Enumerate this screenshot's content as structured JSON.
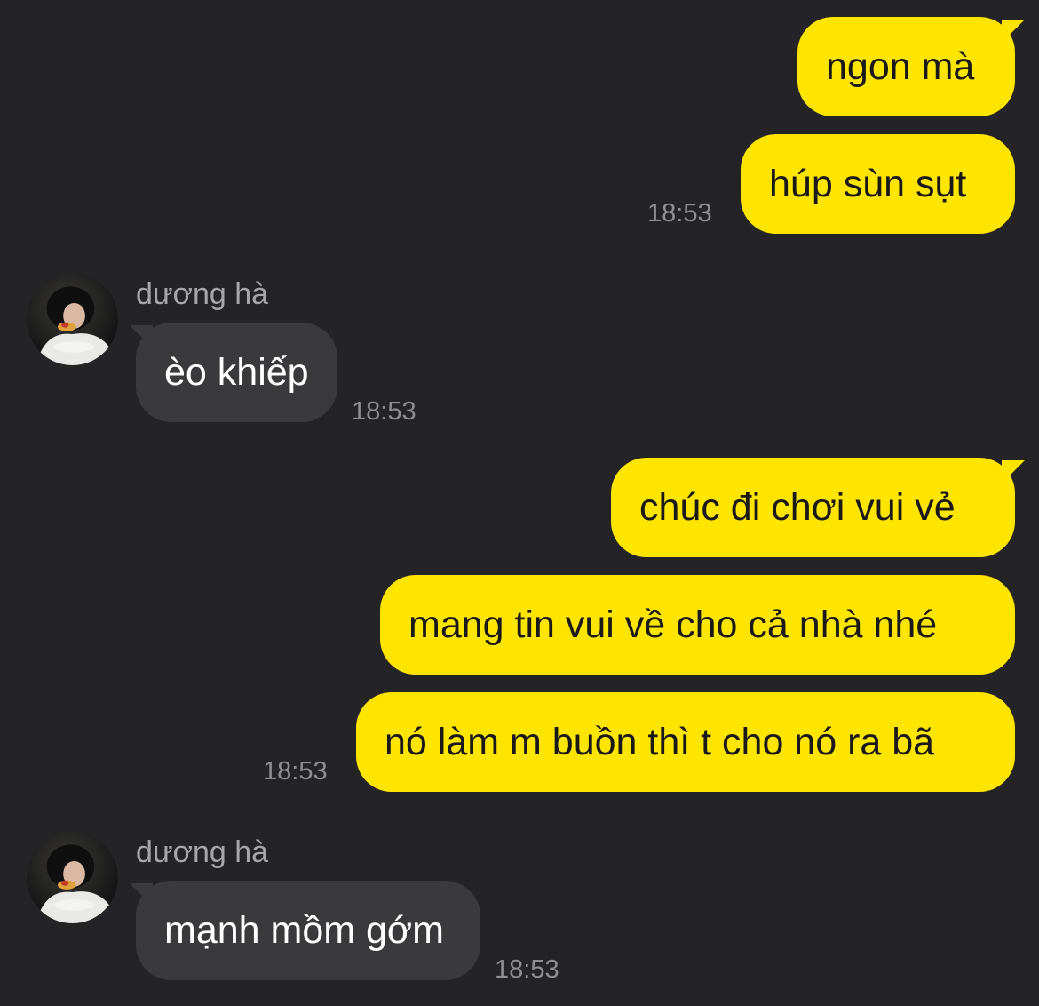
{
  "contact": {
    "name": "dương hà"
  },
  "messages": [
    {
      "side": "out",
      "text": "ngon mà"
    },
    {
      "side": "out",
      "text": "húp sùn sụt",
      "time": "18:53"
    },
    {
      "side": "in",
      "sender": "dương hà",
      "text": "èo khiếp",
      "time": "18:53"
    },
    {
      "side": "out",
      "text": "chúc đi chơi vui vẻ"
    },
    {
      "side": "out",
      "text": "mang tin vui về cho cả nhà nhé"
    },
    {
      "side": "out",
      "text": "nó làm m buồn thì t cho nó ra bã",
      "time": "18:53"
    },
    {
      "side": "in",
      "sender": "dương hà",
      "text": "mạnh mồm gớm",
      "time": "18:53"
    }
  ],
  "colors": {
    "background": "#242426",
    "outgoing_bubble": "#FEE500",
    "incoming_bubble": "#3A3A3C",
    "timestamp": "#8E8E93"
  }
}
